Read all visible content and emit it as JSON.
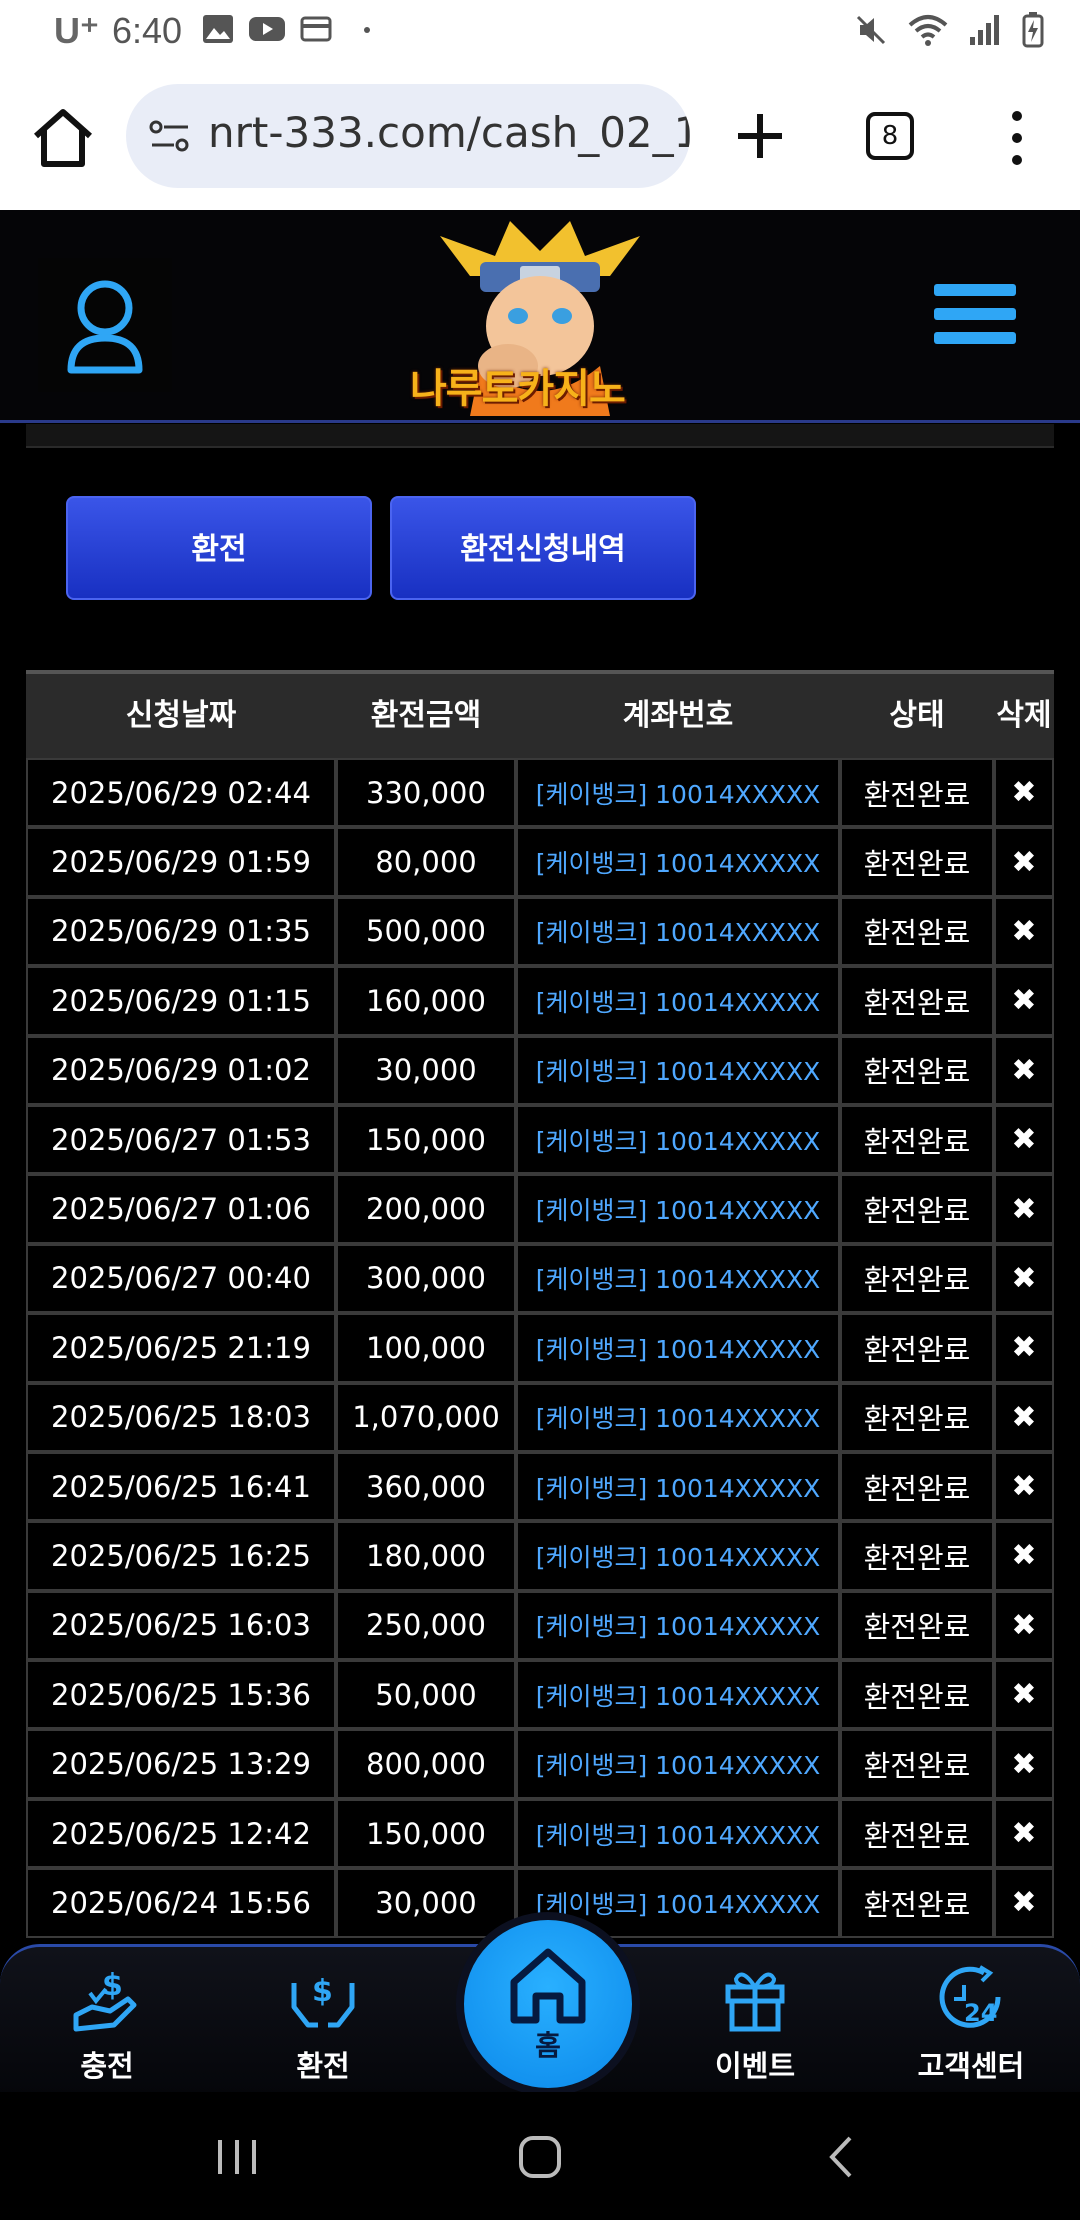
{
  "status_bar": {
    "carrier": "U⁺",
    "time": "6:40"
  },
  "browser": {
    "url": "nrt-333.com/cash_02_1",
    "tab_count": "8"
  },
  "site": {
    "logo_text": "나루토카지노"
  },
  "tabs": [
    {
      "label": "환전"
    },
    {
      "label": "환전신청내역"
    }
  ],
  "table": {
    "headers": [
      "신청날짜",
      "환전금액",
      "계좌번호",
      "상태",
      "삭제"
    ],
    "rows": [
      {
        "date": "2025/06/29 02:44",
        "amount": "330,000",
        "account": "[케이뱅크] 10014XXXXX",
        "status": "환전완료",
        "del": "✖"
      },
      {
        "date": "2025/06/29 01:59",
        "amount": "80,000",
        "account": "[케이뱅크] 10014XXXXX",
        "status": "환전완료",
        "del": "✖"
      },
      {
        "date": "2025/06/29 01:35",
        "amount": "500,000",
        "account": "[케이뱅크] 10014XXXXX",
        "status": "환전완료",
        "del": "✖"
      },
      {
        "date": "2025/06/29 01:15",
        "amount": "160,000",
        "account": "[케이뱅크] 10014XXXXX",
        "status": "환전완료",
        "del": "✖"
      },
      {
        "date": "2025/06/29 01:02",
        "amount": "30,000",
        "account": "[케이뱅크] 10014XXXXX",
        "status": "환전완료",
        "del": "✖"
      },
      {
        "date": "2025/06/27 01:53",
        "amount": "150,000",
        "account": "[케이뱅크] 10014XXXXX",
        "status": "환전완료",
        "del": "✖"
      },
      {
        "date": "2025/06/27 01:06",
        "amount": "200,000",
        "account": "[케이뱅크] 10014XXXXX",
        "status": "환전완료",
        "del": "✖"
      },
      {
        "date": "2025/06/27 00:40",
        "amount": "300,000",
        "account": "[케이뱅크] 10014XXXXX",
        "status": "환전완료",
        "del": "✖"
      },
      {
        "date": "2025/06/25 21:19",
        "amount": "100,000",
        "account": "[케이뱅크] 10014XXXXX",
        "status": "환전완료",
        "del": "✖"
      },
      {
        "date": "2025/06/25 18:03",
        "amount": "1,070,000",
        "account": "[케이뱅크] 10014XXXXX",
        "status": "환전완료",
        "del": "✖"
      },
      {
        "date": "2025/06/25 16:41",
        "amount": "360,000",
        "account": "[케이뱅크] 10014XXXXX",
        "status": "환전완료",
        "del": "✖"
      },
      {
        "date": "2025/06/25 16:25",
        "amount": "180,000",
        "account": "[케이뱅크] 10014XXXXX",
        "status": "환전완료",
        "del": "✖"
      },
      {
        "date": "2025/06/25 16:03",
        "amount": "250,000",
        "account": "[케이뱅크] 10014XXXXX",
        "status": "환전완료",
        "del": "✖"
      },
      {
        "date": "2025/06/25 15:36",
        "amount": "50,000",
        "account": "[케이뱅크] 10014XXXXX",
        "status": "환전완료",
        "del": "✖"
      },
      {
        "date": "2025/06/25 13:29",
        "amount": "800,000",
        "account": "[케이뱅크] 10014XXXXX",
        "status": "환전완료",
        "del": "✖"
      },
      {
        "date": "2025/06/25 12:42",
        "amount": "150,000",
        "account": "[케이뱅크] 10014XXXXX",
        "status": "환전완료",
        "del": "✖"
      },
      {
        "date": "2025/06/24 15:56",
        "amount": "30,000",
        "account": "[케이뱅크] 10014XXXXX",
        "status": "환전완료",
        "del": "✖"
      }
    ]
  },
  "bottom_nav": {
    "charge": "충전",
    "exchange": "환전",
    "home": "홈",
    "event": "이벤트",
    "support": "고객센터"
  },
  "colors": {
    "accent_blue": "#2fa6f5",
    "button_blue": "#2340d6",
    "account_link": "#4fa8ff"
  }
}
